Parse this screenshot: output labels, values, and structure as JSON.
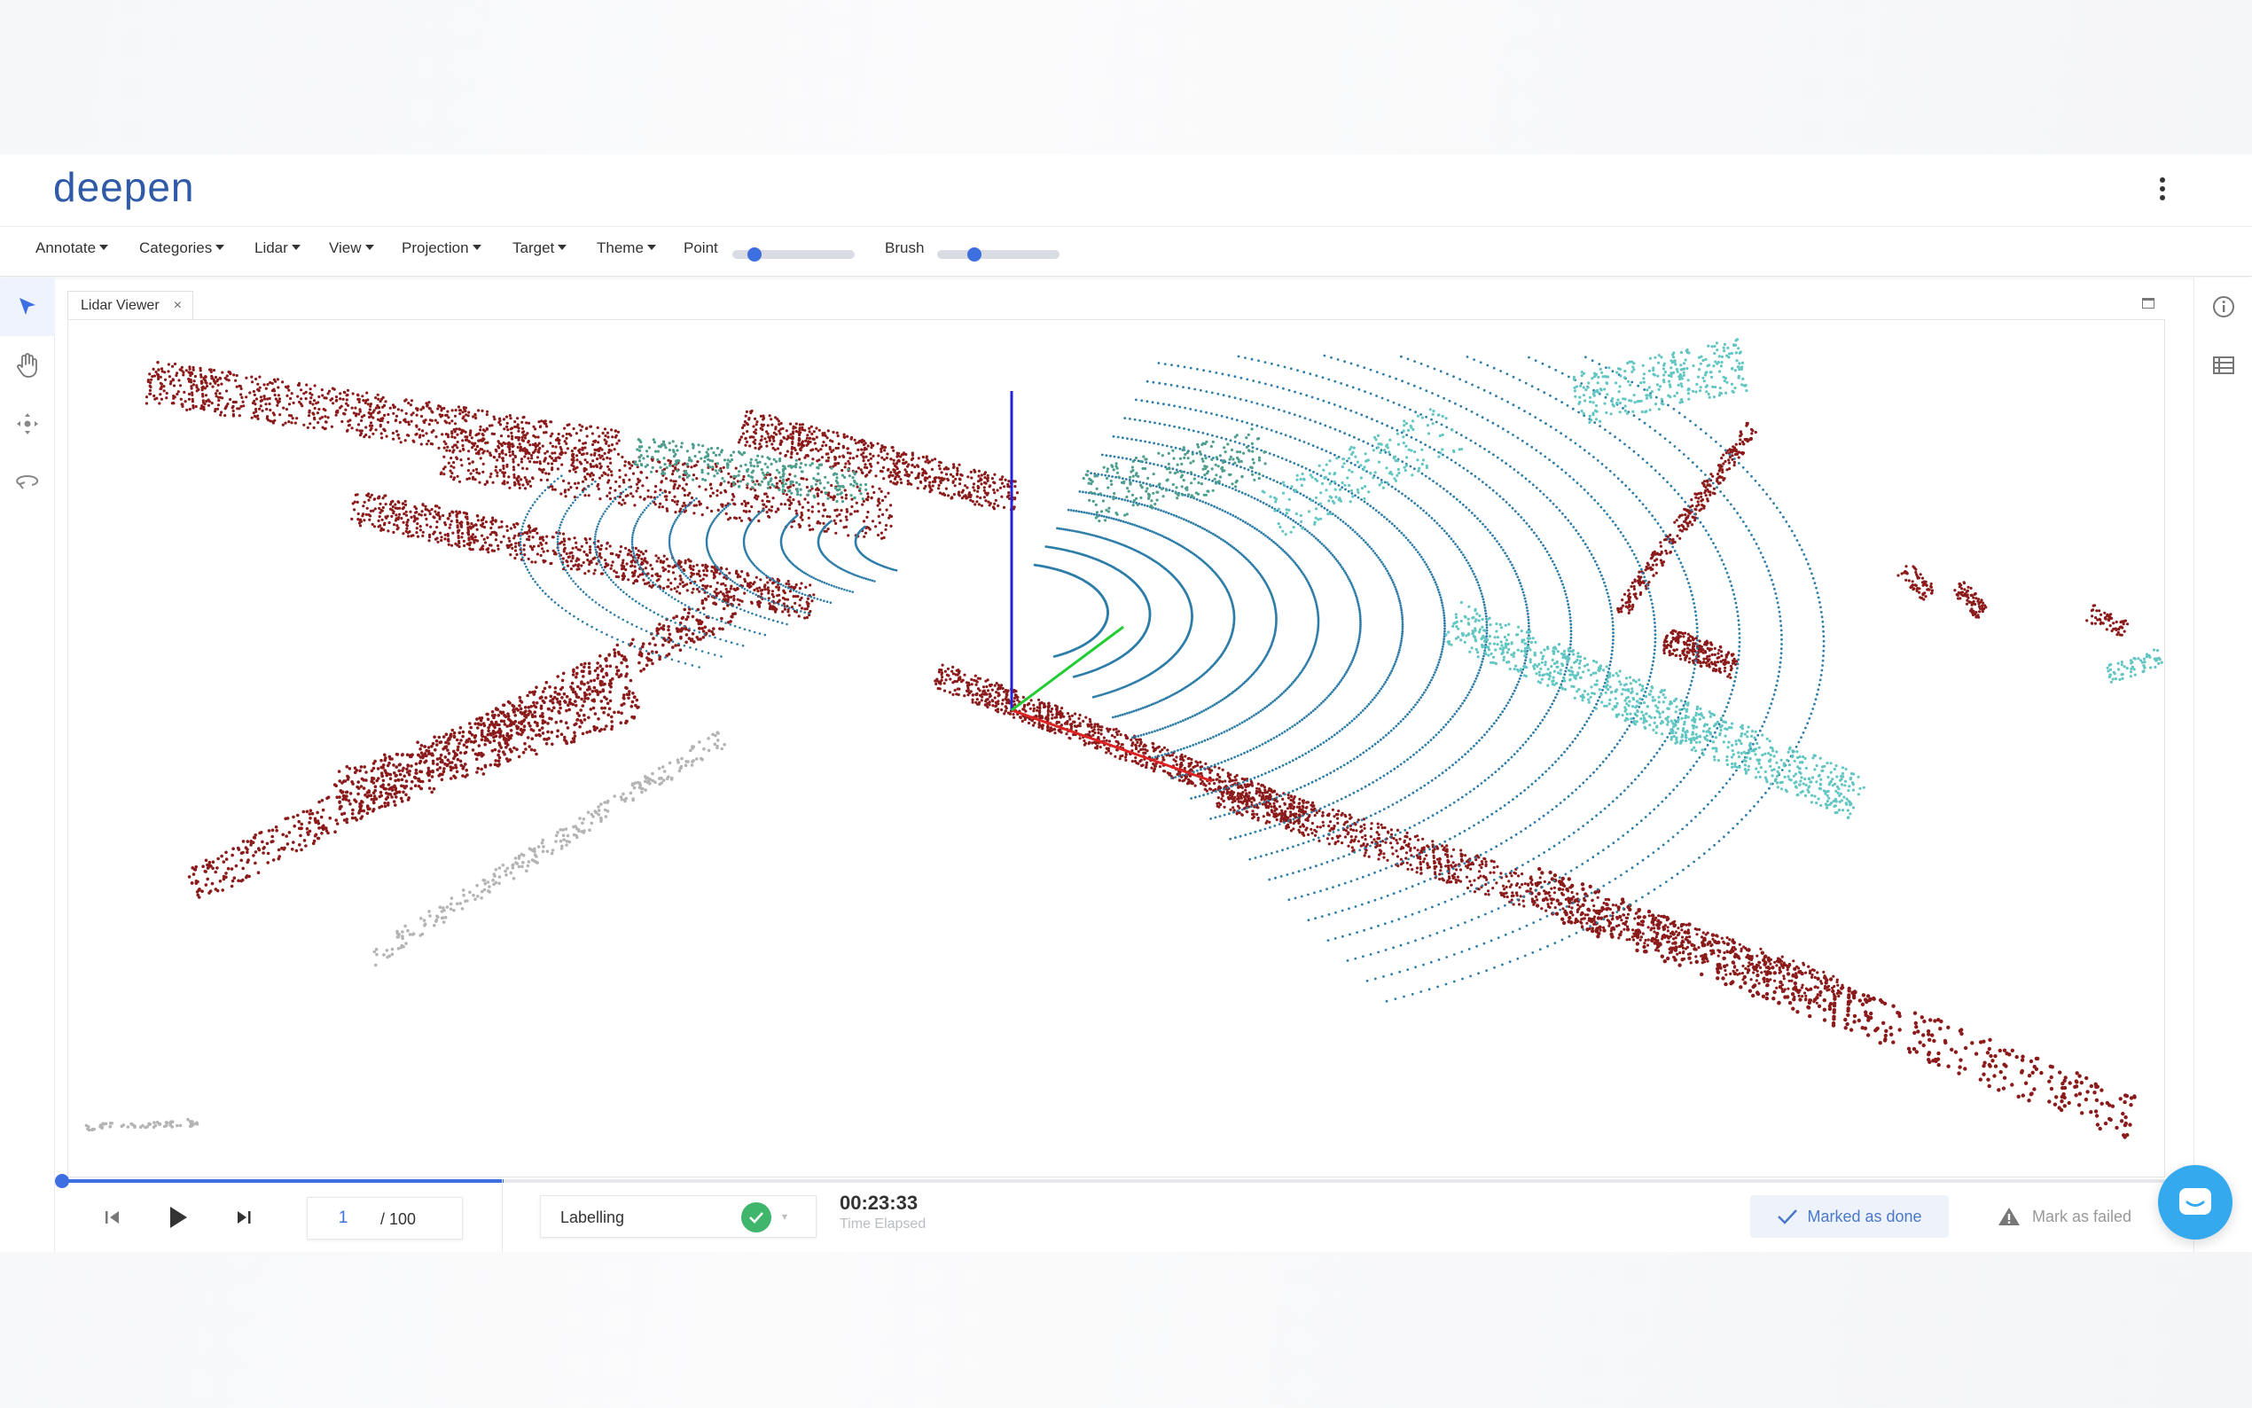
{
  "app": {
    "logo": "deepen"
  },
  "toolbar": {
    "menus": [
      "Annotate",
      "Categories",
      "Lidar",
      "View",
      "Projection",
      "Target",
      "Theme"
    ],
    "point_label": "Point",
    "point_level": 0.14,
    "brush_label": "Brush",
    "brush_level": 0.28
  },
  "left_tools": [
    "select-arrow-icon",
    "hand-pan-icon",
    "move-arrows-icon",
    "rotate-icon"
  ],
  "right_tools": [
    "info-icon",
    "table-list-icon"
  ],
  "viewer": {
    "tab_label": "Lidar Viewer",
    "close_symbol": "×"
  },
  "playback": {
    "progress": 0.21,
    "frame_current": "1",
    "frame_total": "/ 100"
  },
  "status": {
    "label": "Labelling",
    "timer": "00:23:33",
    "timer_caption": "Time Elapsed"
  },
  "actions": {
    "done_label": "Marked as done",
    "fail_label": "Mark as failed"
  },
  "colors": {
    "accent": "#3d6fe0",
    "success": "#3fb66b",
    "chat": "#35a9ee",
    "cloud_red": "#8b1a1a",
    "cloud_blue": "#2d7da8",
    "cloud_teal": "#62c6c2",
    "cloud_gray": "#b4b4b4"
  }
}
